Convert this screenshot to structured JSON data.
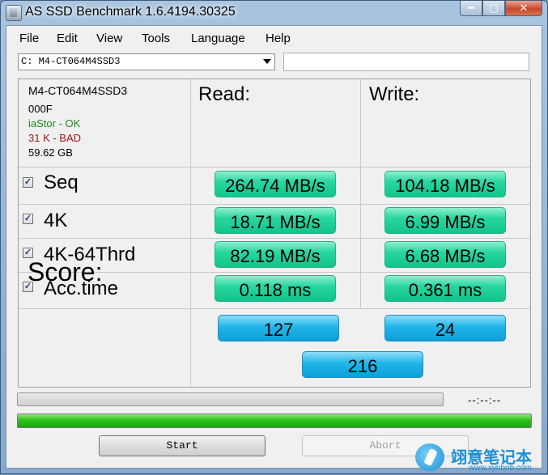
{
  "window": {
    "title": "AS SSD Benchmark 1.6.4194.30325"
  },
  "menu": {
    "file": "File",
    "edit": "Edit",
    "view": "View",
    "tools": "Tools",
    "language": "Language",
    "help": "Help"
  },
  "drive": {
    "selected": "C: M4-CT064M4SSD3",
    "extra_field": ""
  },
  "info": {
    "model": "M4-CT064M4SSD3",
    "firmware": "000F",
    "driver": "iaStor - OK",
    "alignment": "31 K - BAD",
    "size": "59.62 GB",
    "driver_color": "#1e8a1e",
    "alignment_color": "#a01818"
  },
  "columns": {
    "read": "Read:",
    "write": "Write:"
  },
  "tests": [
    {
      "label": "Seq",
      "checked": true,
      "read": "264.74 MB/s",
      "write": "104.18 MB/s"
    },
    {
      "label": "4K",
      "checked": true,
      "read": "18.71 MB/s",
      "write": "6.99 MB/s"
    },
    {
      "label": "4K-64Thrd",
      "checked": true,
      "read": "82.19 MB/s",
      "write": "6.68 MB/s"
    },
    {
      "label": "Acc.time",
      "checked": true,
      "read": "0.118 ms",
      "write": "0.361 ms"
    }
  ],
  "score": {
    "label": "Score:",
    "read": "127",
    "write": "24",
    "total": "216"
  },
  "progress": {
    "time": "--:--:--",
    "test_fraction": 0,
    "total_fraction": 1
  },
  "buttons": {
    "start": "Start",
    "abort": "Abort"
  },
  "watermark": {
    "text": "翊意笔记本",
    "url": "www.xynbnb.com"
  },
  "colors": {
    "result_green": "#2ad6a0",
    "score_blue": "#20b6ea",
    "progress_green": "#2fc11b"
  }
}
